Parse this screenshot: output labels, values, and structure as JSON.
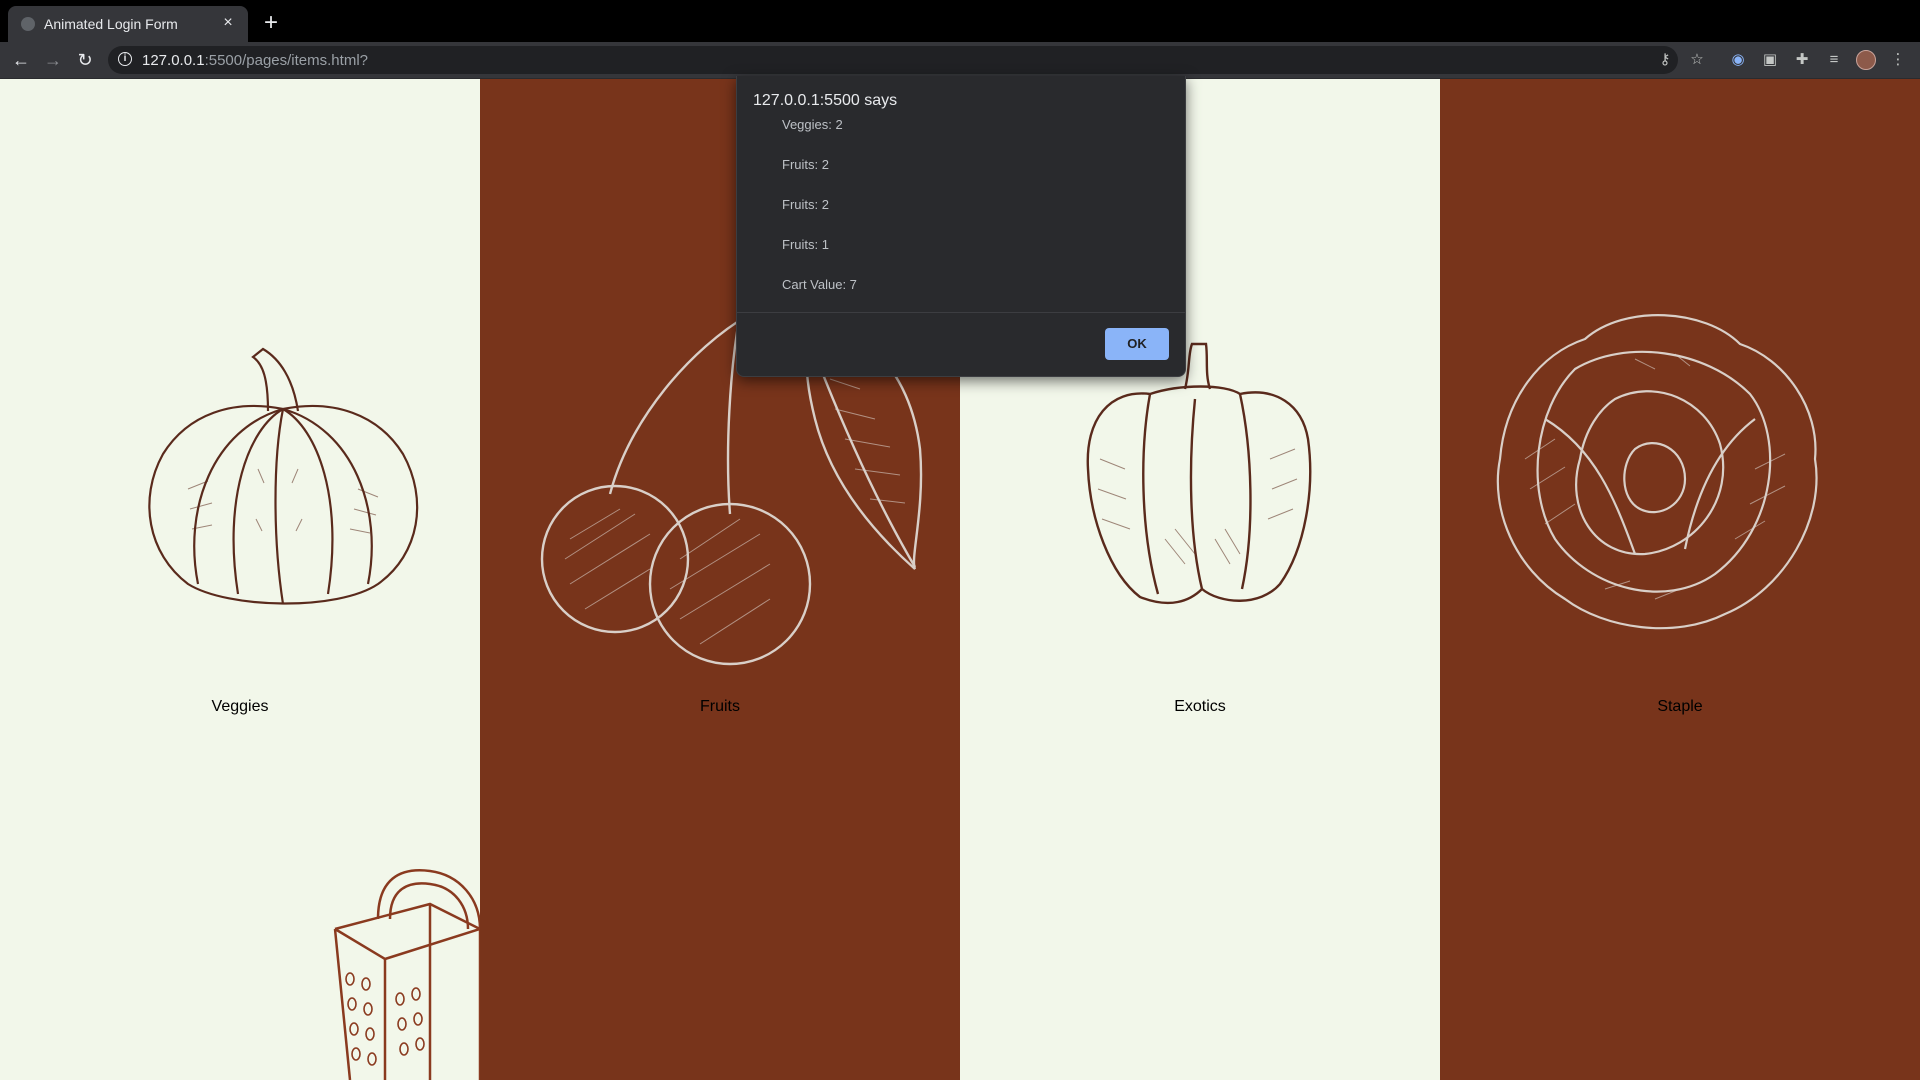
{
  "browser": {
    "tab_title": "Animated Login Form",
    "close_glyph": "×",
    "new_tab_glyph": "+",
    "url_host": "127.0.0.1",
    "url_rest": ":5500/pages/items.html?",
    "back_glyph": "←",
    "forward_glyph": "→",
    "reload_glyph": "↻",
    "info_glyph": "i"
  },
  "toolbar_icons": [
    "key-icon",
    "star-icon",
    "extension-circle-icon",
    "clipboard-icon",
    "puzzle-icon",
    "media-queue-icon",
    "profile-avatar",
    "menu-dots-icon"
  ],
  "toolbar_glyphs": {
    "key": "⚷",
    "star": "☆",
    "circle": "◉",
    "clipboard": "▣",
    "puzzle": "✚",
    "queue": "≡",
    "menu": "⋮"
  },
  "categories": [
    {
      "label": "Veggies",
      "theme": "light"
    },
    {
      "label": "Fruits",
      "theme": "dark"
    },
    {
      "label": "Exotics",
      "theme": "light"
    },
    {
      "label": "Staple",
      "theme": "dark"
    }
  ],
  "colors": {
    "light_panel": "#f2f7ea",
    "dark_panel": "#78341b",
    "ink_dark": "#5a2a1c",
    "ink_light": "#d9cfc8",
    "dialog_bg": "#292a2d",
    "ok_button": "#8ab4f8"
  },
  "alert": {
    "title": "127.0.0.1:5500 says",
    "lines": [
      "Veggies: 2",
      "Fruits: 2",
      "Fruits: 2",
      "Fruits: 1",
      "Cart Value: 7"
    ],
    "ok_label": "OK"
  }
}
